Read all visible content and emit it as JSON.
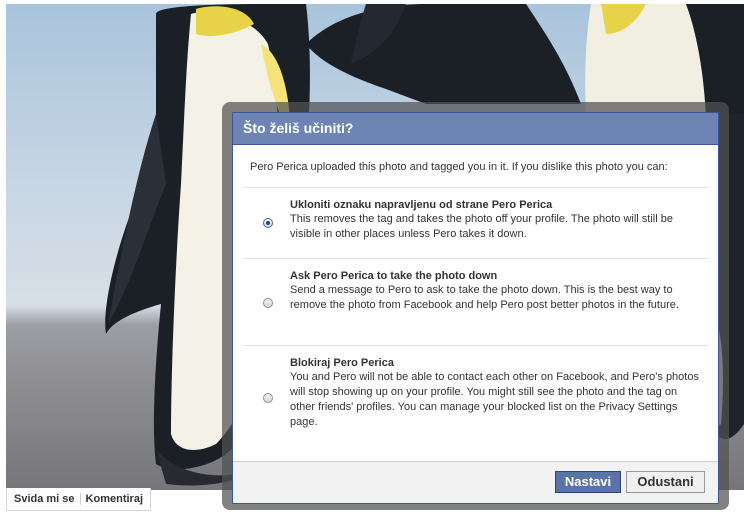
{
  "photo": {
    "description_icon": "penguins-photo"
  },
  "photo_actions": {
    "like_label": "Svida mi se",
    "comment_label": "Komentiraj"
  },
  "dialog": {
    "title": "Što želiš učiniti?",
    "intro": "Pero Perica uploaded this photo and tagged you in it. If you dislike this photo you can:",
    "options": [
      {
        "title": "Ukloniti oznaku napravljenu od strane Pero Perica",
        "description": "This removes the tag and takes the photo off your profile. The photo will still be visible in other places unless Pero takes it down.",
        "selected": true
      },
      {
        "title": "Ask Pero Perica to take the photo down",
        "description": "Send a message to Pero to ask to take the photo down. This is the best way to remove the photo from Facebook and help Pero post better photos in the future.",
        "selected": false
      },
      {
        "title": "Blokiraj Pero Perica",
        "description": "You and Pero will not be able to contact each other on Facebook, and Pero's photos will stop showing up on your profile. You might still see the photo and the tag on other friends' profiles. You can manage your blocked list on the Privacy Settings page.",
        "selected": false
      }
    ],
    "continue_label": "Nastavi",
    "cancel_label": "Odustani"
  },
  "colors": {
    "header_bg": "#6d84b4",
    "primary_button": "#5b74a8",
    "border_blue": "#3b5998"
  }
}
